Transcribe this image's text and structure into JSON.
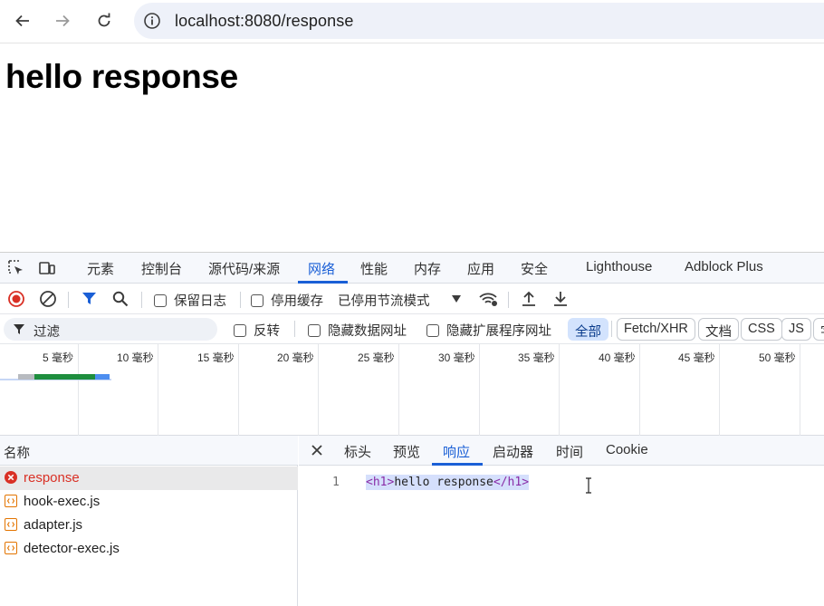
{
  "browser": {
    "url": "localhost:8080/response"
  },
  "page": {
    "heading": "hello response"
  },
  "devtools": {
    "tabs": [
      "元素",
      "控制台",
      "源代码/来源",
      "网络",
      "性能",
      "内存",
      "应用",
      "安全",
      "Lighthouse",
      "Adblock Plus"
    ],
    "active_tab": "网络",
    "toolbar": {
      "preserve_log": "保留日志",
      "disable_cache": "停用缓存",
      "throttling": "已停用节流模式"
    },
    "filter": {
      "placeholder": "过滤",
      "invert": "反转",
      "hide_data_urls": "隐藏数据网址",
      "hide_extension_urls": "隐藏扩展程序网址",
      "types": [
        "全部",
        "Fetch/XHR",
        "文档",
        "CSS",
        "JS",
        "字"
      ]
    },
    "timeline": {
      "ticks": [
        "5 毫秒",
        "10 毫秒",
        "15 毫秒",
        "20 毫秒",
        "25 毫秒",
        "30 毫秒",
        "35 毫秒",
        "40 毫秒",
        "45 毫秒",
        "50 毫秒"
      ]
    },
    "requests": {
      "header": "名称",
      "items": [
        {
          "name": "response",
          "status": "error"
        },
        {
          "name": "hook-exec.js",
          "status": "ok"
        },
        {
          "name": "adapter.js",
          "status": "ok"
        },
        {
          "name": "detector-exec.js",
          "status": "ok"
        }
      ]
    },
    "details": {
      "tabs": [
        "标头",
        "预览",
        "响应",
        "启动器",
        "时间",
        "Cookie"
      ],
      "active_tab": "响应",
      "response": {
        "line_number": "1",
        "open_tag": "<h1>",
        "text": "hello response",
        "close_tag": "</h1>"
      }
    }
  },
  "colors": {
    "accent": "#1a5fd6",
    "error": "#d93025",
    "js_icon": "#e37400",
    "timeline_green": "#1e8e3e"
  }
}
